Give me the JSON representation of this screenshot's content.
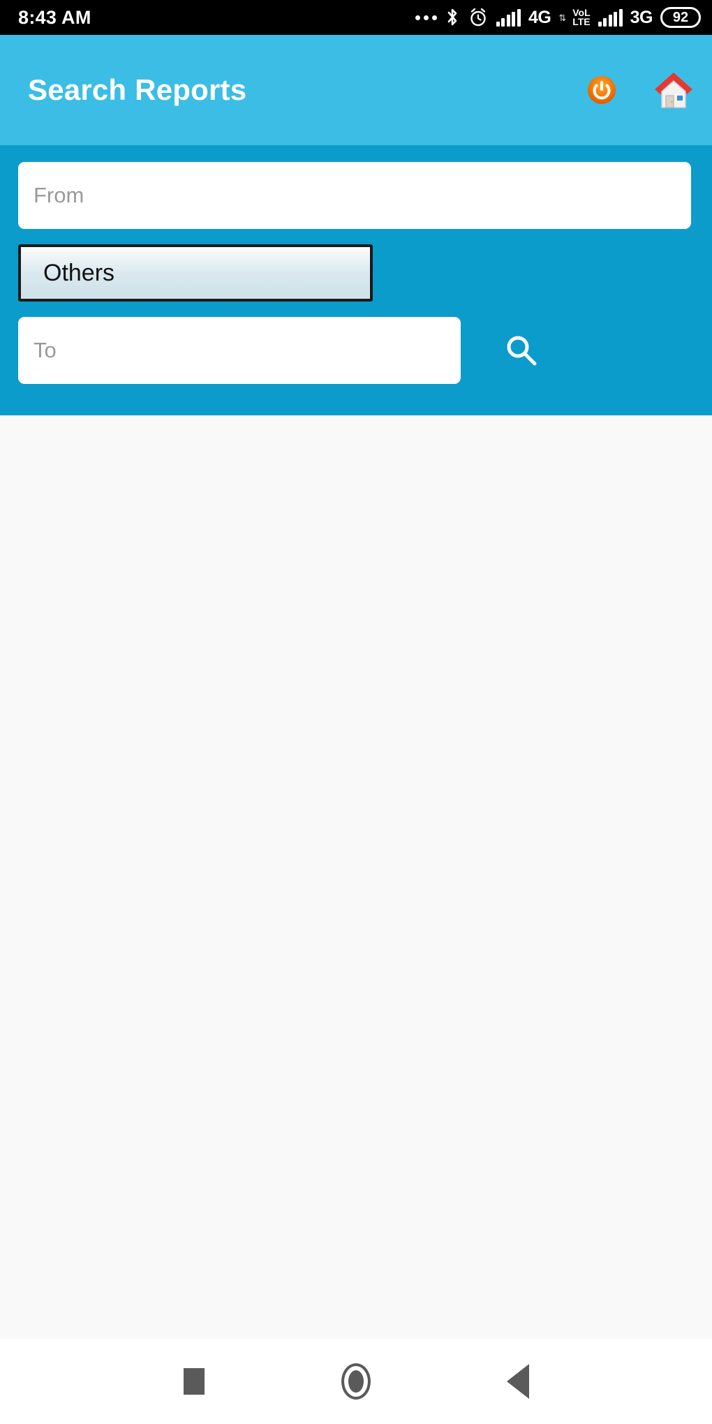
{
  "status_bar": {
    "time": "8:43 AM",
    "icons": {
      "more_dots": "more-dots-icon",
      "bluetooth": "bluetooth-icon",
      "alarm": "alarm-clock-icon",
      "signal_1": "signal-bars-icon",
      "network_1": "4G",
      "data_arrows": "data-transfer-icon",
      "volte_top": "VoL",
      "volte_bottom": "LTE",
      "signal_2": "signal-bars-icon",
      "network_2": "3G",
      "battery_level": "92"
    }
  },
  "app_bar": {
    "title": "Search Reports",
    "power_icon": "power-icon",
    "home_icon": "home-icon"
  },
  "search_form": {
    "from_value": "",
    "from_placeholder": "From",
    "to_value": "",
    "to_placeholder": "To",
    "category_selected": "Others",
    "search_icon": "search-icon"
  },
  "nav_bar": {
    "recents": "recents-square-icon",
    "home": "home-circle-icon",
    "back": "back-triangle-icon"
  },
  "colors": {
    "app_bar": "#3bbde5",
    "panel": "#0b9ccc",
    "body": "#f9f9f9",
    "power_accent": "#ef6c00",
    "roof_red": "#e8372f"
  }
}
